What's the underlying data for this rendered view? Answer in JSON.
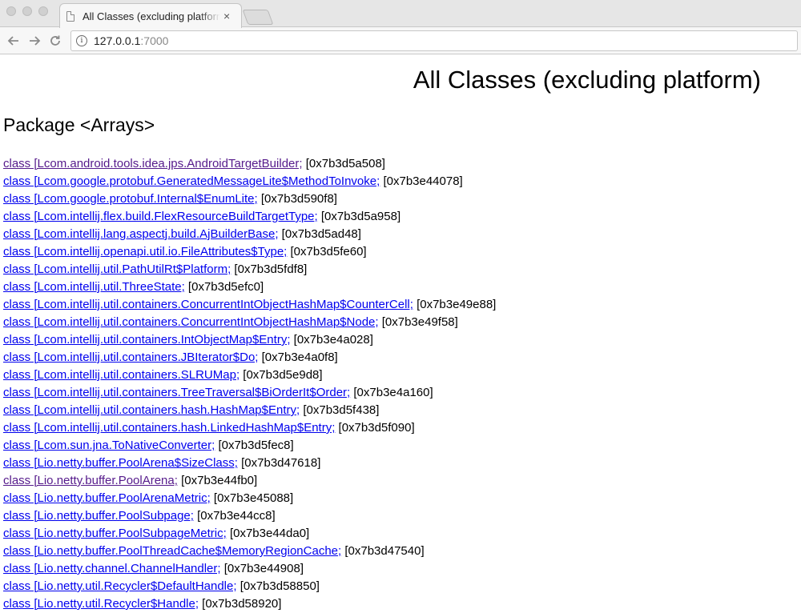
{
  "browser": {
    "tab_title": "All Classes (excluding platform)",
    "tab_close": "×",
    "url_host": "127.0.0.1",
    "url_port": ":7000"
  },
  "page": {
    "title": "All Classes (excluding platform)",
    "package_heading": "Package <Arrays>",
    "classes": [
      {
        "name": "class [Lcom.android.tools.idea.jps.AndroidTargetBuilder;",
        "addr": " [0x7b3d5a508]",
        "visited": true
      },
      {
        "name": "class [Lcom.google.protobuf.GeneratedMessageLite$MethodToInvoke;",
        "addr": " [0x7b3e44078]",
        "visited": false
      },
      {
        "name": "class [Lcom.google.protobuf.Internal$EnumLite;",
        "addr": " [0x7b3d590f8]",
        "visited": false
      },
      {
        "name": "class [Lcom.intellij.flex.build.FlexResourceBuildTargetType;",
        "addr": " [0x7b3d5a958]",
        "visited": false
      },
      {
        "name": "class [Lcom.intellij.lang.aspectj.build.AjBuilderBase;",
        "addr": " [0x7b3d5ad48]",
        "visited": false
      },
      {
        "name": "class [Lcom.intellij.openapi.util.io.FileAttributes$Type;",
        "addr": " [0x7b3d5fe60]",
        "visited": false
      },
      {
        "name": "class [Lcom.intellij.util.PathUtilRt$Platform;",
        "addr": " [0x7b3d5fdf8]",
        "visited": false
      },
      {
        "name": "class [Lcom.intellij.util.ThreeState;",
        "addr": " [0x7b3d5efc0]",
        "visited": false
      },
      {
        "name": "class [Lcom.intellij.util.containers.ConcurrentIntObjectHashMap$CounterCell;",
        "addr": " [0x7b3e49e88]",
        "visited": false
      },
      {
        "name": "class [Lcom.intellij.util.containers.ConcurrentIntObjectHashMap$Node;",
        "addr": " [0x7b3e49f58]",
        "visited": false
      },
      {
        "name": "class [Lcom.intellij.util.containers.IntObjectMap$Entry;",
        "addr": " [0x7b3e4a028]",
        "visited": false
      },
      {
        "name": "class [Lcom.intellij.util.containers.JBIterator$Do;",
        "addr": " [0x7b3e4a0f8]",
        "visited": false
      },
      {
        "name": "class [Lcom.intellij.util.containers.SLRUMap;",
        "addr": " [0x7b3d5e9d8]",
        "visited": false
      },
      {
        "name": "class [Lcom.intellij.util.containers.TreeTraversal$BiOrderIt$Order;",
        "addr": " [0x7b3e4a160]",
        "visited": false
      },
      {
        "name": "class [Lcom.intellij.util.containers.hash.HashMap$Entry;",
        "addr": " [0x7b3d5f438]",
        "visited": false
      },
      {
        "name": "class [Lcom.intellij.util.containers.hash.LinkedHashMap$Entry;",
        "addr": " [0x7b3d5f090]",
        "visited": false
      },
      {
        "name": "class [Lcom.sun.jna.ToNativeConverter;",
        "addr": " [0x7b3d5fec8]",
        "visited": false
      },
      {
        "name": "class [Lio.netty.buffer.PoolArena$SizeClass;",
        "addr": " [0x7b3d47618]",
        "visited": false
      },
      {
        "name": "class [Lio.netty.buffer.PoolArena;",
        "addr": " [0x7b3e44fb0]",
        "visited": true
      },
      {
        "name": "class [Lio.netty.buffer.PoolArenaMetric;",
        "addr": " [0x7b3e45088]",
        "visited": false
      },
      {
        "name": "class [Lio.netty.buffer.PoolSubpage;",
        "addr": " [0x7b3e44cc8]",
        "visited": false
      },
      {
        "name": "class [Lio.netty.buffer.PoolSubpageMetric;",
        "addr": " [0x7b3e44da0]",
        "visited": false
      },
      {
        "name": "class [Lio.netty.buffer.PoolThreadCache$MemoryRegionCache;",
        "addr": " [0x7b3d47540]",
        "visited": false
      },
      {
        "name": "class [Lio.netty.channel.ChannelHandler;",
        "addr": " [0x7b3e44908]",
        "visited": false
      },
      {
        "name": "class [Lio.netty.util.Recycler$DefaultHandle;",
        "addr": " [0x7b3d58850]",
        "visited": false
      },
      {
        "name": "class [Lio.netty.util.Recycler$Handle;",
        "addr": " [0x7b3d58920]",
        "visited": false
      }
    ]
  }
}
